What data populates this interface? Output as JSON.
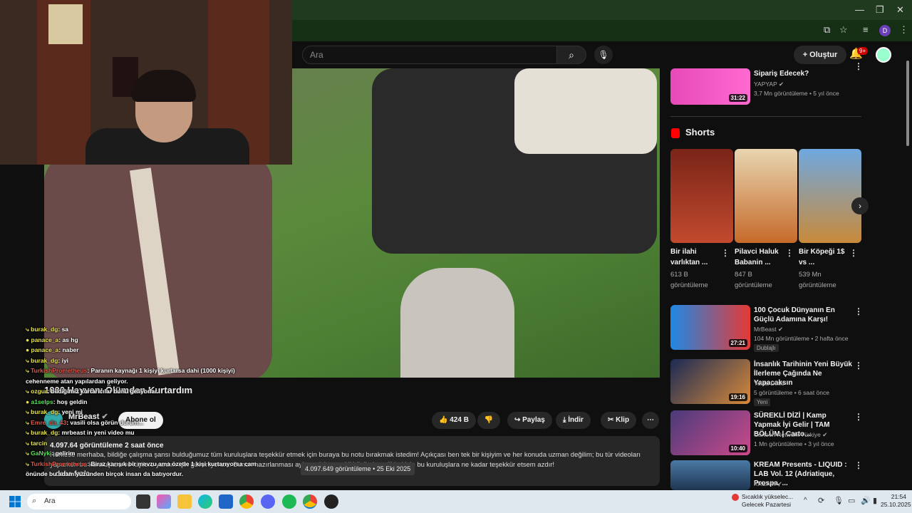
{
  "header": {
    "search_placeholder": "Ara",
    "create_label": "Oluştur",
    "notif_count": "9+",
    "profile_letter": "D"
  },
  "video": {
    "overlay_title": "1000 Hayvanı Ölümden Kurtardım",
    "channel_name": "MrBeast",
    "subscribe_label": "Abone ol",
    "likes": "424 B",
    "share_label": "Paylaş",
    "download_label": "İndir",
    "clip_label": "Klip",
    "views_short": "4.097.64",
    "time_ago": "2 saat önce",
    "views_suffix": "görüntüleme",
    "description": "Herkese merhaba, bildiğe çalışma şansı bulduğumuz tüm kuruluşlara teşekkür etmek için buraya bu notu bırakmak istedim! Açıkçası ben tek bir kişiyim ve her konuda uzman değilim; bu tür videoları yaparken bu kuruluşlara ve kişilere yardım için güveniyorum. Bunun hazırlanması aylar ... için gerekli bilgileri verdikleri için bu kuruluşlara ne kadar teşekkür etsem azdır!",
    "more_label": "daha fazla",
    "tooltip": "4.097.649 görüntüleme • 25 Eki 2025"
  },
  "chat": [
    {
      "user": "burak_dg",
      "msg": ": sa",
      "cls": "",
      "badge": ""
    },
    {
      "user": "panace_a",
      "msg": ": as hg",
      "cls": "",
      "badge": "!"
    },
    {
      "user": "panace_a",
      "msg": ": naber",
      "cls": "",
      "badge": "!"
    },
    {
      "user": "burak_dg",
      "msg": ": iyi",
      "cls": "",
      "badge": ""
    },
    {
      "user": "TurkishPrometheus",
      "msg": ": Paranın kaynağı 1 kişiyi kurtarsa dahi (1000 kişiyi)",
      "cls": "red",
      "badge": ""
    },
    {
      "user": "",
      "msg": "cehenneme atan yapılardan geliyor.",
      "cls": "",
      "badge": ""
    },
    {
      "user": "ozgur",
      "msg": ": bildiğimiz kurtarıcılar bunu geliyorlar.",
      "cls": "",
      "badge": ""
    },
    {
      "user": "a1selps",
      "msg": ": hoş geldin",
      "cls": "green",
      "badge": "!"
    },
    {
      "user": "burak_dg",
      "msg": ": yeni mi",
      "cls": "",
      "badge": ""
    },
    {
      "user": "Emre_da_43",
      "msg": ": vasili olsa görün durum...",
      "cls": "red",
      "badge": ""
    },
    {
      "user": "burak_dg",
      "msg": ": mrbeast in yeni video mu",
      "cls": "",
      "badge": ""
    },
    {
      "user": "tarcin",
      "msg": "",
      "cls": "",
      "badge": ""
    },
    {
      "user": "GaNyki",
      "msg": ": gelirim",
      "cls": "green",
      "badge": ""
    },
    {
      "user": "",
      "msg": "",
      "cls": "",
      "badge": ""
    },
    {
      "user": "TurkishPrometheus",
      "msg": ": Biraz karışık bir mevzu ama özetle 1 kişi kurtarıyorsa cam",
      "cls": "red",
      "badge": ""
    },
    {
      "user": "",
      "msg": "önünde bu adam yüzünden birçok insan da batıyordur.",
      "cls": "",
      "badge": ""
    }
  ],
  "sidebar": {
    "top_item": {
      "title": "Sipariş Edecek?",
      "channel": "YAPYAP",
      "meta": "3,7 Mn görüntüleme • 5 yıl önce",
      "duration": "31:22"
    },
    "shorts_heading": "Shorts",
    "shorts": [
      {
        "title": "Bir ilahi varlıktan ...",
        "views": "613 B görüntüleme"
      },
      {
        "title": "Pilavci Haluk Babanin ...",
        "views": "847 B görüntüleme"
      },
      {
        "title": "Bir Köpeği 1$ vs ...",
        "views": "539 Mn görüntüleme"
      }
    ],
    "videos": [
      {
        "title": "100 Çocuk Dünyanın En Güçlü Adamına Karşı!",
        "channel": "MrBeast",
        "meta": "104 Mn görüntüleme • 2 hafta önce",
        "tag": "Dublajlı",
        "duration": "27:21"
      },
      {
        "title": "İnsanlık Tarihinin Yeni Büyük İlerleme Çağında Ne Yapacaksın",
        "channel": "Yolda Dinle",
        "meta": "5 görüntüleme • 6 saat önce",
        "tag": "Yeni",
        "duration": "19:16"
      },
      {
        "title": "SÜREKLİ DİZİ | Kamp Yapmak İyi Gelir | TAM BÖLÜM | Carto...",
        "channel": "Cartoon Network Türkiye",
        "meta": "1 Mn görüntüleme • 3 yıl önce",
        "tag": "",
        "duration": "10:40"
      },
      {
        "title": "KREAM Presents - LIQUID : LAB Vol. 12 (Adriatique, Prospa, ...",
        "channel": "KREAM",
        "meta": "",
        "tag": "",
        "duration": ""
      }
    ]
  },
  "taskbar": {
    "search_placeholder": "Ara",
    "weather_line1": "Sıcaklık yükselec...",
    "weather_line2": "Gelecek Pazartesi",
    "time": "21:54",
    "date": "25.10.2025"
  }
}
